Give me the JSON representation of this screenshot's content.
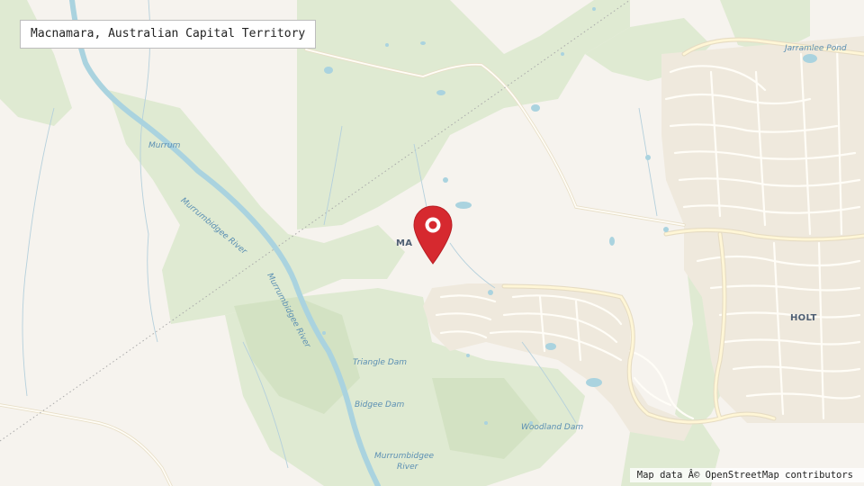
{
  "map": {
    "title": "Macnamara, Australian Capital Territory",
    "attribution": "Map data Â© OpenStreetMap contributors",
    "marker_label": "MA",
    "suburb_labels": {
      "holt": "HOLT"
    },
    "water_labels": {
      "jarramlee_pond": "Jarramlee Pond",
      "murrumbidgee_river_diagonal": "Murrumbidgee River",
      "murrumbidgee_river_bottom": "Murrumbidgee",
      "murrumbidgee_river_bottom_2": "River",
      "murrum_top": "Murrum",
      "triangle_dam": "Triangle Dam",
      "bidgee_dam": "Bidgee Dam",
      "woodland_dam": "Woodland Dam"
    },
    "colors": {
      "background": "#f6f3ee",
      "park_green": "#dfead2",
      "water": "#aad3df",
      "road": "#fffdf7",
      "road_casing": "#e6dcc3",
      "marker": "#d6292f"
    },
    "icons": [
      "map-pin-icon"
    ]
  }
}
